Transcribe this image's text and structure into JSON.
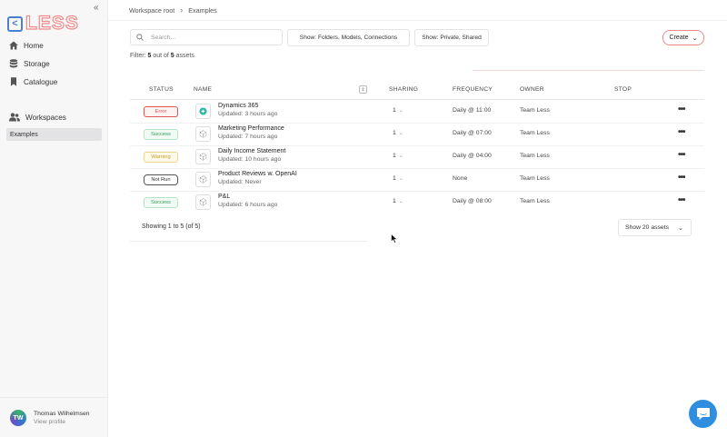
{
  "sidebar": {
    "logo_text": "LESS",
    "collapse_icon": "double-chevron-left-icon",
    "nav": [
      {
        "label": "Home",
        "icon": "home-icon"
      },
      {
        "label": "Storage",
        "icon": "database-icon"
      },
      {
        "label": "Catalogue",
        "icon": "bookmark-icon"
      }
    ],
    "workspaces_label": "Workspaces",
    "workspace_item": "Examples",
    "user": {
      "initials": "TW",
      "name": "Thomas Wilhelmsen",
      "link": "View profile"
    }
  },
  "breadcrumb": [
    "Workspace root",
    "Examples"
  ],
  "toolbar": {
    "search_placeholder": "Search...",
    "filter_types": "Show: Folders, Models, Connections",
    "filter_visibility": "Show: Private, Shared",
    "create_label": "Create"
  },
  "filter": {
    "prefix": "Filter:",
    "shown": "5",
    "middle": "out of",
    "total": "5",
    "suffix": "assets"
  },
  "table": {
    "columns": [
      "STATUS",
      "NAME",
      "SHARING",
      "FREQUENCY",
      "OWNER",
      "STOP"
    ],
    "rows": [
      {
        "status": "Error",
        "name": "Dynamics 365",
        "updated": "Updated: 3 hours ago",
        "sharing": "1",
        "frequency": "Daily @ 11:00",
        "owner": "Team Less",
        "icon": "dynamics-connector-icon"
      },
      {
        "status": "Success",
        "name": "Marketing Performance",
        "updated": "Updated: 7 hours ago",
        "sharing": "1",
        "frequency": "Daily @ 07:00",
        "owner": "Team Less",
        "icon": "model-cube-icon"
      },
      {
        "status": "Warning",
        "name": "Daily Income Statement",
        "updated": "Updated: 10 hours ago",
        "sharing": "1",
        "frequency": "Daily @ 04:00",
        "owner": "Team Less",
        "icon": "model-cube-icon"
      },
      {
        "status": "Not Run",
        "name": "Product Reviews w. OpenAI",
        "updated": "Updated: Never",
        "sharing": "1",
        "frequency": "None",
        "owner": "Team Less",
        "icon": "model-cube-icon"
      },
      {
        "status": "Success",
        "name": "P&L",
        "updated": "Updated: 6 hours ago",
        "sharing": "1",
        "frequency": "Daily @ 08:00",
        "owner": "Team Less",
        "icon": "model-cube-icon"
      }
    ]
  },
  "pagination": {
    "showing": "Showing 1 to 5 (of 5)",
    "page_size": "Show 20 assets"
  },
  "colors": {
    "error": "#e25555",
    "success": "#2f9e5a",
    "warning": "#c99a1a",
    "notrun": "#555555",
    "accent": "#e98a8a",
    "chat": "#2f8ee0"
  }
}
